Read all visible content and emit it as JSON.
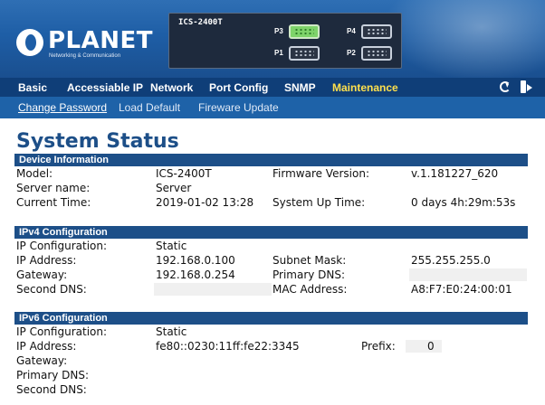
{
  "header": {
    "brand": "PLANET",
    "brand_sub": "Networking & Communication",
    "device_name": "ICS-2400T",
    "ports": [
      {
        "label": "P3",
        "active": true
      },
      {
        "label": "P4",
        "active": false
      },
      {
        "label": "P1",
        "active": false
      },
      {
        "label": "P2",
        "active": false
      }
    ]
  },
  "nav": {
    "items": [
      {
        "label": "Basic"
      },
      {
        "label": "Accessiable IP"
      },
      {
        "label": "Network"
      },
      {
        "label": "Port Config"
      },
      {
        "label": "SNMP"
      },
      {
        "label": "Maintenance"
      }
    ],
    "active": "Maintenance",
    "icons": [
      "refresh-icon",
      "logout-icon"
    ]
  },
  "subnav": {
    "items": [
      {
        "label": "Change Password"
      },
      {
        "label": "Load Default"
      },
      {
        "label": "Fireware Update"
      }
    ],
    "active": "Change Password"
  },
  "page": {
    "title": "System Status"
  },
  "device_info": {
    "header": "Device Information",
    "model_label": "Model:",
    "model": "ICS-2400T",
    "firmware_label": "Firmware Version:",
    "firmware": "v.1.181227_620",
    "server_name_label": "Server name:",
    "server_name": "Server",
    "current_time_label": "Current Time:",
    "current_time": "2019-01-02 13:28",
    "uptime_label": "System Up Time:",
    "uptime": "0 days 4h:29m:53s"
  },
  "ipv4": {
    "header": "IPv4 Configuration",
    "ip_config_label": "IP Configuration:",
    "ip_config": "Static",
    "ip_label": "IP Address:",
    "ip": "192.168.0.100",
    "subnet_label": "Subnet Mask:",
    "subnet": "255.255.255.0",
    "gateway_label": "Gateway:",
    "gateway": "192.168.0.254",
    "primary_dns_label": "Primary DNS:",
    "primary_dns": "",
    "second_dns_label": "Second DNS:",
    "second_dns": "",
    "mac_label": "MAC Address:",
    "mac": "A8:F7:E0:24:00:01"
  },
  "ipv6": {
    "header": "IPv6 Configuration",
    "ip_config_label": "IP Configuration:",
    "ip_config": "Static",
    "ip_label": "IP Address:",
    "ip": "fe80::0230:11ff:fe22:3345",
    "prefix_label": "Prefix:",
    "prefix": "0",
    "gateway_label": "Gateway:",
    "gateway": "",
    "primary_dns_label": "Primary DNS:",
    "primary_dns": "",
    "second_dns_label": "Second DNS:",
    "second_dns": ""
  },
  "colors": {
    "banner": "#1e5ea6",
    "nav": "#0f3e78",
    "subnav": "#1e62a8",
    "section_header": "#1d4f88",
    "active_nav": "#ffe04d",
    "port_active": "#7ed36a",
    "row_shade": "#e9eaec"
  }
}
